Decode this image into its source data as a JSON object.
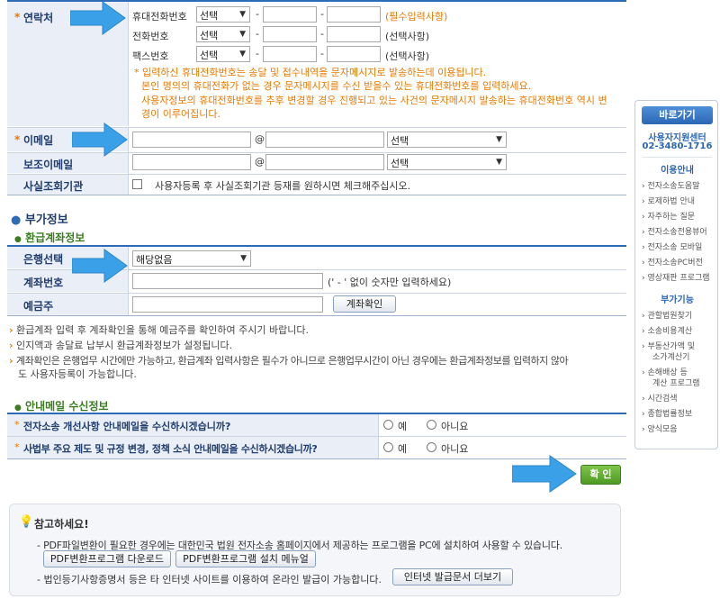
{
  "contact": {
    "label": "연락처",
    "mobile_label": "휴대전화번호",
    "phone_label": "전화번호",
    "fax_label": "팩스번호",
    "select_value": "선택",
    "dash": "-",
    "mobile_note": "(필수입력사항)",
    "optional_note": "(선택사항)",
    "warning_1": "* 입력하신 휴대전화번호는 송달 및 접수내역을 문자메시지로 발송하는데 이용됩니다.",
    "warning_2": "본인 명의의 휴대전화가 없는 경우 문자메시지를 수신 받을수 있는 휴대전화번호를 입력하세요.",
    "warning_3": "사용자정보의 휴대전화번호를 추후 변경할 경우 진행되고 있는 사건의 문자메시지 발송하는 휴대전화번호 역시 변",
    "warning_4": "경이 이루어집니다."
  },
  "email": {
    "label": "이메일",
    "sub_label": "보조이메일",
    "at": "@",
    "select_value": "선택"
  },
  "fact_check": {
    "label": "사실조회기관",
    "text": "사용자등록 후 사실조회기관 등재를 원하시면 체크해주십시오."
  },
  "extra": {
    "title": "부가정보",
    "refund_title": "환급계좌정보",
    "bank_label": "은행선택",
    "bank_value": "해당없음",
    "account_label": "계좌번호",
    "account_note": "(' - ' 없이 숫자만 입력하세요)",
    "holder_label": "예금주",
    "check_button": "계좌확인",
    "bullets": [
      "환급계좌 입력 후 계좌확인을 통해 예금주를 확인하여 주시기 바랍니다.",
      "인지액과 송달료 납부시 환급계좌정보가 설정됩니다.",
      "계좌확인은 은행업무 시간에만 가능하고, 환급계좌 입력사항은 필수가 아니므로 은행업무시간이 아닌 경우에는 환급계좌정보를 입력하지 않아",
      "도 사용자등록이 가능합니다."
    ]
  },
  "mail_info": {
    "title": "안내메일 수신정보",
    "q1": "전자소송 개선사항 안내메일을 수신하시겠습니까?",
    "q2": "사법부 주요 제도 및 규정 변경, 정책 소식 안내메일을 수신하시겠습니까?",
    "yes": "예",
    "no": "아니요"
  },
  "confirm_button": "확 인",
  "notice": {
    "title": "참고하세요!",
    "line1": "- PDF파일변환이 필요한 경우에는 대한민국 법원 전자소송 홈페이지에서 제공하는 프로그램을 PC에 설치하여 사용할 수 있습니다.",
    "btn_download": "PDF변환프로그램 다운로드",
    "btn_manual": "PDF변환프로그램 설치 메뉴얼",
    "line2": "- 법인등기사항증명서 등은 타 인터넷 사이트를 이용하여 온라인 발급이 가능합니다.",
    "btn_more": "인터넷 발급문서 더보기"
  },
  "side": {
    "title": "바로가기",
    "center": "사용자지원센터",
    "phone": "02-3480-1716",
    "cat1": "이용안내",
    "items1": [
      "전자소송도움말",
      "로제하법 안내",
      "자주하는 질문",
      "전자소송전용뷰어",
      "전자소송 모바일",
      "전자소송PC버전",
      "영상재판 프로그램"
    ],
    "cat2": "부가기능",
    "items2": [
      "관할법원찾기",
      "소송비용계산",
      "부동산가액 및",
      "소가계산기",
      "손해배상 등",
      "계산 프로그램",
      "시간검색",
      "종합법률정보",
      "양식모음"
    ]
  },
  "colors": {
    "accent": "#2e6bb6",
    "header_bg": "#e9eef7",
    "warning": "#e87a00",
    "arrow": "#3aa0e8",
    "confirm": "#5aa82c"
  }
}
